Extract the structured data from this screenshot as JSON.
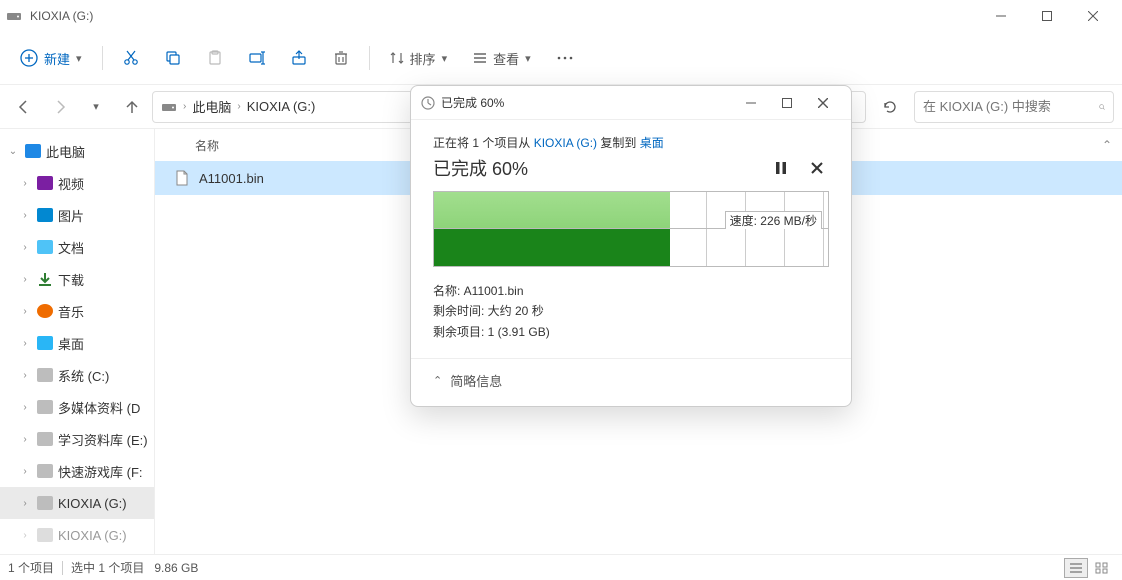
{
  "window": {
    "title": "KIOXIA (G:)"
  },
  "toolbar": {
    "new_label": "新建",
    "sort_label": "排序",
    "view_label": "查看"
  },
  "breadcrumb": {
    "root": "此电脑",
    "current": "KIOXIA (G:)"
  },
  "search": {
    "placeholder": "在 KIOXIA (G:) 中搜索"
  },
  "sidebar": {
    "this_pc": "此电脑",
    "items": [
      {
        "label": "视频"
      },
      {
        "label": "图片"
      },
      {
        "label": "文档"
      },
      {
        "label": "下载"
      },
      {
        "label": "音乐"
      },
      {
        "label": "桌面"
      },
      {
        "label": "系统 (C:)"
      },
      {
        "label": "多媒体资料 (D"
      },
      {
        "label": "学习资料库 (E:)"
      },
      {
        "label": "快速游戏库 (F:"
      },
      {
        "label": "KIOXIA (G:)"
      },
      {
        "label": "KIOXIA (G:)"
      }
    ]
  },
  "columns": {
    "name": "名称"
  },
  "file": {
    "name": "A11001.bin"
  },
  "status": {
    "count": "1 个项目",
    "selected": "选中 1 个项目",
    "size": "9.86 GB"
  },
  "dialog": {
    "title": "已完成 60%",
    "copying_prefix": "正在将 1 个项目从 ",
    "copying_src": "KIOXIA (G:)",
    "copying_mid": " 复制到 ",
    "copying_dest": "桌面",
    "progress_text": "已完成 60%",
    "speed": "速度: 226 MB/秒",
    "detail_name_label": "名称: ",
    "detail_name": "A11001.bin",
    "detail_time_label": "剩余时间: ",
    "detail_time": "大约 20 秒",
    "detail_items_label": "剩余项目: ",
    "detail_items": "1 (3.91 GB)",
    "footer": "简略信息",
    "progress_percent": 60
  }
}
